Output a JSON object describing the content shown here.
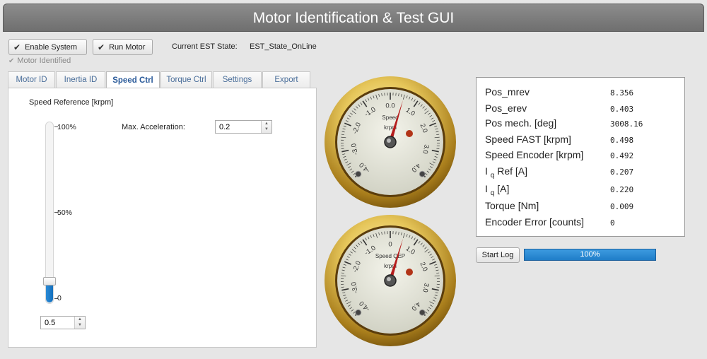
{
  "window": {
    "title": "Motor Identification & Test GUI"
  },
  "toolbar": {
    "enable_system": "Enable System",
    "run_motor": "Run Motor",
    "est_state_label": "Current EST State:",
    "est_state_value": "EST_State_OnLine",
    "motor_identified": "Motor Identified"
  },
  "tabs": [
    {
      "label": "Motor ID"
    },
    {
      "label": "Inertia ID"
    },
    {
      "label": "Speed Ctrl"
    },
    {
      "label": "Torque Ctrl"
    },
    {
      "label": "Settings"
    },
    {
      "label": "Export"
    }
  ],
  "speed_ctrl": {
    "speed_reference_label": "Speed Reference [krpm]",
    "slider_ticks": [
      "100%",
      "50%",
      "0"
    ],
    "slider_value_fraction": 0.12,
    "max_acceleration_label": "Max. Acceleration:",
    "max_acceleration_value": "0.2",
    "speed_reference_value": "0.5"
  },
  "gauges": [
    {
      "label": "Speed",
      "unit": "krpm",
      "value": 0.5,
      "ticks": [
        "-4.0",
        "-3.0",
        "-2.0",
        "-1.0",
        "0.0",
        "1.0",
        "2.0",
        "3.0",
        "4.0"
      ]
    },
    {
      "label": "Speed QEP",
      "unit": "krpm",
      "value": 0.5,
      "ticks": [
        "-4.0",
        "-3.0",
        "-2.0",
        "-1.0",
        "0",
        "1.0",
        "2.0",
        "3.0",
        "4.0"
      ]
    }
  ],
  "readout": {
    "rows": [
      {
        "label": "Pos_mrev",
        "value": "8.356"
      },
      {
        "label": "Pos_erev",
        "value": "0.403"
      },
      {
        "label": "Pos mech. [deg]",
        "value": "3008.16"
      },
      {
        "label": "Speed FAST [krpm]",
        "value": "0.498"
      },
      {
        "label": "Speed Encoder [krpm]",
        "value": "0.492"
      },
      {
        "label_pre": "I",
        "label_sub": "q",
        "label_post": "Ref [A]",
        "value": "0.207"
      },
      {
        "label_pre": "I",
        "label_sub": "q",
        "label_post": "[A]",
        "value": "0.220"
      },
      {
        "label": "Torque [Nm]",
        "value": "0.009"
      },
      {
        "label": "Encoder Error [counts]",
        "value": "0"
      }
    ]
  },
  "log": {
    "start_log": "Start Log",
    "progress_text": "100%",
    "progress_fraction": 1.0
  }
}
